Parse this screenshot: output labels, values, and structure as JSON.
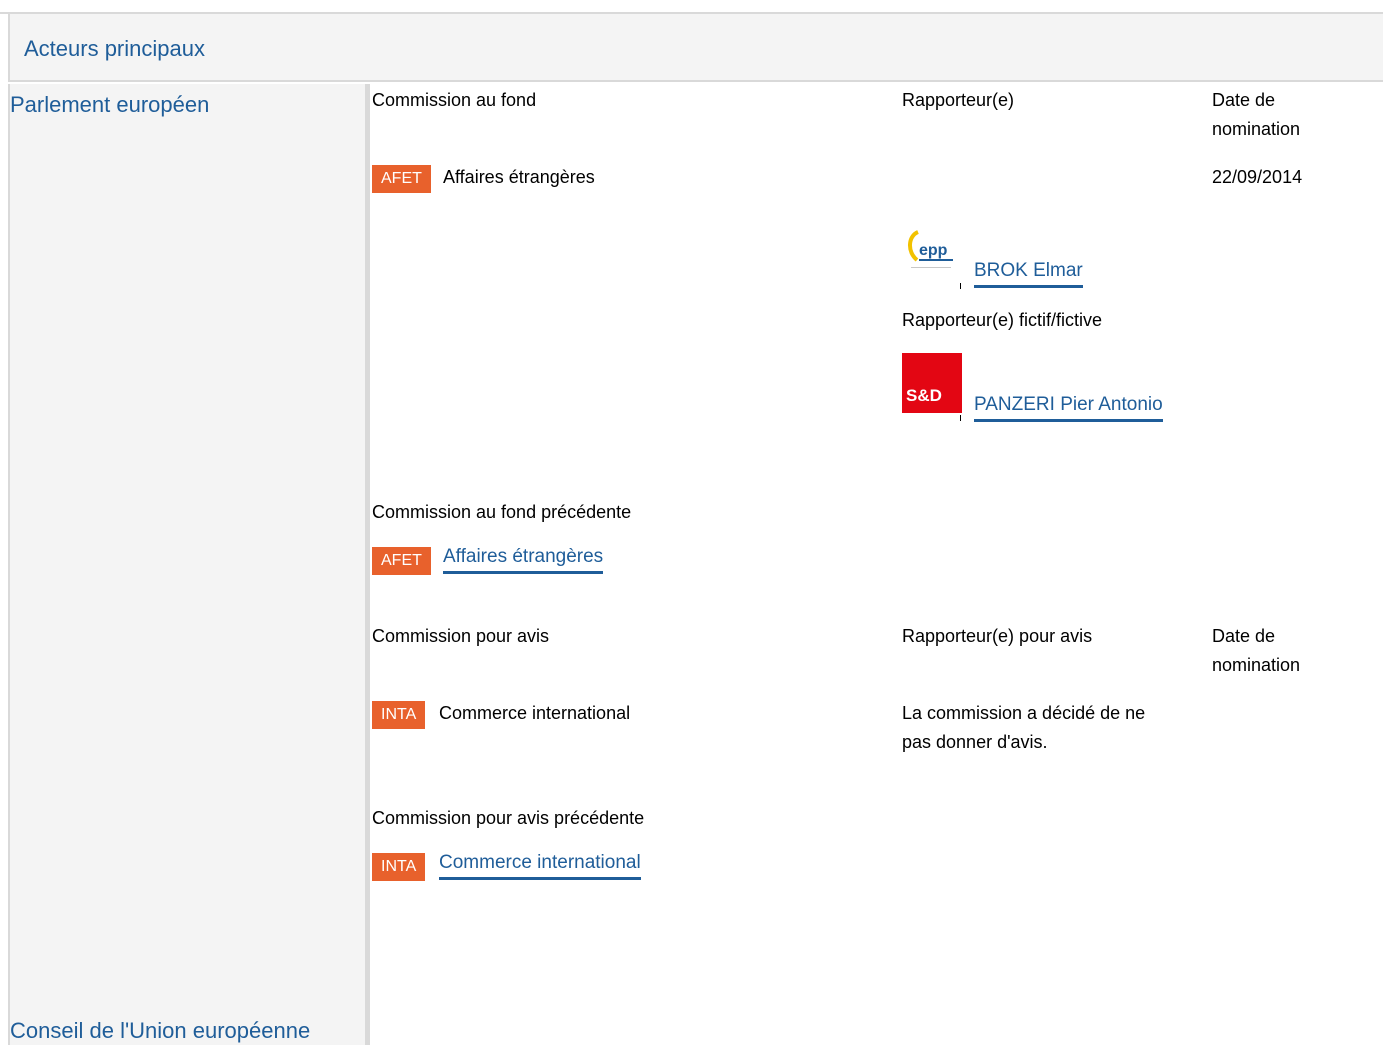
{
  "section_title": "Acteurs principaux",
  "institutions": {
    "ep": "Parlement européen",
    "council": "Conseil de l'Union européenne"
  },
  "lead": {
    "header_committee": "Commission au fond",
    "header_rapporteur": "Rapporteur(e)",
    "header_date_line1": "Date de",
    "header_date_line2": "nomination",
    "badge": "AFET",
    "name": "Affaires étrangères",
    "date": "22/09/2014",
    "rapporteur_link": "BROK Elmar",
    "rapporteur_logo": "epp",
    "shadow_label": "Rapporteur(e) fictif/fictive",
    "shadow_logo": "S&D",
    "shadow_link": "PANZERI Pier Antonio"
  },
  "previous_lead": {
    "label": "Commission au fond précédente",
    "badge": "AFET",
    "link": "Affaires étrangères"
  },
  "opinion": {
    "header_committee": "Commission pour avis",
    "header_rapporteur": "Rapporteur(e) pour avis",
    "header_date_line1": "Date de",
    "header_date_line2": "nomination",
    "badge": "INTA",
    "name": "Commerce international",
    "note_line1": "La commission a décidé de ne",
    "note_line2": "pas donner d'avis."
  },
  "previous_opinion": {
    "label": "Commission pour avis précédente",
    "badge": "INTA",
    "link": "Commerce international"
  },
  "colors": {
    "link": "#1f5d99",
    "badge": "#e8612c",
    "panel": "#f4f4f4"
  }
}
